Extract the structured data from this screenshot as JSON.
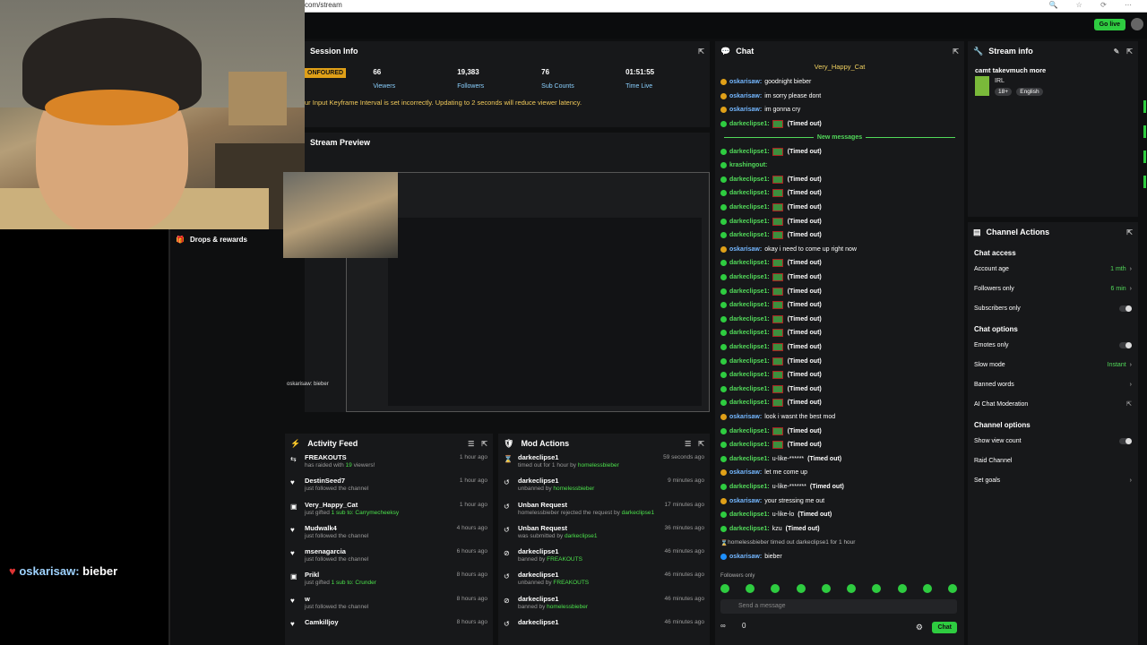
{
  "browser": {
    "url": "com/stream"
  },
  "topbar": {
    "go_live": "Go live"
  },
  "overlay": {
    "chat_user": "oskarisaw:",
    "chat_text": "bieber",
    "small_overlay": "oskarisaw: bieber"
  },
  "drops": {
    "title": "Drops & rewards"
  },
  "session": {
    "title": "Session Info",
    "badge": "ONFOURED",
    "stats": [
      {
        "value": "66",
        "label": "Viewers"
      },
      {
        "value": "19,383",
        "label": "Followers"
      },
      {
        "value": "76",
        "label": "Sub Counts"
      },
      {
        "value": "01:51:55",
        "label": "Time Live"
      }
    ],
    "warning": "ur Input Keyframe Interval is set incorrectly. Updating to 2 seconds will reduce viewer latency."
  },
  "preview": {
    "title": "Stream Preview"
  },
  "activity": {
    "title": "Activity Feed",
    "items": [
      {
        "icon": "raid-icon",
        "name": "FREAKOUTS",
        "sub_pre": "has raided with ",
        "sub_hl": "19",
        "sub_post": " viewers!",
        "time": "1 hour ago"
      },
      {
        "icon": "heart-icon",
        "name": "DestinSeed7",
        "sub_pre": "just followed the channel",
        "sub_hl": "",
        "sub_post": "",
        "time": "1 hour ago"
      },
      {
        "icon": "gift-icon",
        "name": "Very_Happy_Cat",
        "sub_pre": "just gifted ",
        "sub_hl": "1 sub to: Carrymecheeksy",
        "sub_post": "",
        "time": "1 hour ago"
      },
      {
        "icon": "heart-icon",
        "name": "Mudwalk4",
        "sub_pre": "just followed the channel",
        "sub_hl": "",
        "sub_post": "",
        "time": "4 hours ago"
      },
      {
        "icon": "heart-icon",
        "name": "msenagarcia",
        "sub_pre": "just followed the channel",
        "sub_hl": "",
        "sub_post": "",
        "time": "6 hours ago"
      },
      {
        "icon": "gift-icon",
        "name": "Prikl",
        "sub_pre": "just gifted ",
        "sub_hl": "1 sub to: Crunder",
        "sub_post": "",
        "time": "8 hours ago"
      },
      {
        "icon": "heart-icon",
        "name": "w",
        "sub_pre": "just followed the channel",
        "sub_hl": "",
        "sub_post": "",
        "time": "8 hours ago"
      },
      {
        "icon": "heart-icon",
        "name": "Camkilljoy",
        "sub_pre": "",
        "sub_hl": "",
        "sub_post": "",
        "time": "8 hours ago"
      }
    ]
  },
  "mod": {
    "title": "Mod Actions",
    "items": [
      {
        "icon": "hourglass-icon",
        "name": "darkeclipse1",
        "sub_pre": "timed out for 1 hour by ",
        "sub_hl": "homelessbieber",
        "time": "59 seconds ago"
      },
      {
        "icon": "undo-icon",
        "name": "darkeclipse1",
        "sub_pre": "unbanned by ",
        "sub_hl": "homelessbieber",
        "time": "9 minutes ago"
      },
      {
        "icon": "undo-icon",
        "name": "Unban Request",
        "sub_pre": "homelessbieber rejected the request by ",
        "sub_hl": "darkeclipse1",
        "time": "17 minutes ago"
      },
      {
        "icon": "undo-icon",
        "name": "Unban Request",
        "sub_pre": "was submitted by ",
        "sub_hl": "darkeclipse1",
        "time": "36 minutes ago"
      },
      {
        "icon": "ban-icon",
        "name": "darkeclipse1",
        "sub_pre": "banned by ",
        "sub_hl": "FREAKOUTS",
        "time": "46 minutes ago"
      },
      {
        "icon": "undo-icon",
        "name": "darkeclipse1",
        "sub_pre": "unbanned by ",
        "sub_hl": "FREAKOUTS",
        "time": "46 minutes ago"
      },
      {
        "icon": "ban-icon",
        "name": "darkeclipse1",
        "sub_pre": "banned by ",
        "sub_hl": "homelessbieber",
        "time": "46 minutes ago"
      },
      {
        "icon": "undo-icon",
        "name": "darkeclipse1",
        "sub_pre": "",
        "sub_hl": "",
        "time": "46 minutes ago"
      }
    ]
  },
  "chat": {
    "title": "Chat",
    "pinned": "Very_Happy_Cat",
    "new_messages": "New messages",
    "timed_out": "(Timed out)",
    "followers_only": "Followers only",
    "placeholder": "Send a message",
    "send": "Chat",
    "foot_left": "∞",
    "foot_count": "0",
    "lines_a": [
      {
        "u": "oskarisaw:",
        "c": "bl",
        "msg": "goodnight bieber",
        "t": false
      },
      {
        "u": "oskarisaw:",
        "c": "bl",
        "msg": "im sorry please dont",
        "t": false
      },
      {
        "u": "oskarisaw:",
        "c": "bl",
        "msg": "im gonna cry",
        "t": false
      },
      {
        "u": "darkeclipse1:",
        "c": "gr",
        "msg": "",
        "t": true
      }
    ],
    "lines_b": [
      {
        "u": "darkeclipse1:",
        "c": "gr",
        "msg": "",
        "t": true
      },
      {
        "u": "krashingout:",
        "c": "gr",
        "msg": "",
        "t": false
      },
      {
        "u": "darkeclipse1:",
        "c": "gr",
        "msg": "",
        "t": true
      },
      {
        "u": "darkeclipse1:",
        "c": "gr",
        "msg": "",
        "t": true
      },
      {
        "u": "darkeclipse1:",
        "c": "gr",
        "msg": "",
        "t": true
      },
      {
        "u": "darkeclipse1:",
        "c": "gr",
        "msg": "",
        "t": true
      },
      {
        "u": "darkeclipse1:",
        "c": "gr",
        "msg": "",
        "t": true
      },
      {
        "u": "oskarisaw:",
        "c": "bl",
        "msg": "okay i need to come up right now",
        "t": false
      },
      {
        "u": "darkeclipse1:",
        "c": "gr",
        "msg": "",
        "t": true
      },
      {
        "u": "darkeclipse1:",
        "c": "gr",
        "msg": "",
        "t": true
      },
      {
        "u": "darkeclipse1:",
        "c": "gr",
        "msg": "",
        "t": true
      },
      {
        "u": "darkeclipse1:",
        "c": "gr",
        "msg": "",
        "t": true
      },
      {
        "u": "darkeclipse1:",
        "c": "gr",
        "msg": "",
        "t": true
      },
      {
        "u": "darkeclipse1:",
        "c": "gr",
        "msg": "",
        "t": true
      },
      {
        "u": "darkeclipse1:",
        "c": "gr",
        "msg": "",
        "t": true
      },
      {
        "u": "darkeclipse1:",
        "c": "gr",
        "msg": "",
        "t": true
      },
      {
        "u": "darkeclipse1:",
        "c": "gr",
        "msg": "",
        "t": true
      },
      {
        "u": "darkeclipse1:",
        "c": "gr",
        "msg": "",
        "t": true
      },
      {
        "u": "darkeclipse1:",
        "c": "gr",
        "msg": "",
        "t": true
      },
      {
        "u": "oskarisaw:",
        "c": "bl",
        "msg": "look i wasnt the best mod",
        "t": false
      },
      {
        "u": "darkeclipse1:",
        "c": "gr",
        "msg": "",
        "t": true
      },
      {
        "u": "darkeclipse1:",
        "c": "gr",
        "msg": "",
        "t": true
      },
      {
        "u": "darkeclipse1:",
        "c": "gr",
        "msg": "u-like-******",
        "t": true
      },
      {
        "u": "oskarisaw:",
        "c": "bl",
        "msg": "let me come up",
        "t": false
      },
      {
        "u": "darkeclipse1:",
        "c": "gr",
        "msg": "u-like-*******",
        "t": true
      },
      {
        "u": "oskarisaw:",
        "c": "bl",
        "msg": "your stressing me out",
        "t": false
      },
      {
        "u": "darkeclipse1:",
        "c": "gr",
        "msg": "u-like-lo",
        "t": true
      },
      {
        "u": "darkeclipse1:",
        "c": "gr",
        "msg": "kzu",
        "t": true
      }
    ],
    "sys_line": "homelessbieber timed out darkeclipse1 for 1 hour",
    "last_user": "oskarisaw:",
    "last_msg": "bieber"
  },
  "streaminfo": {
    "title": "Stream info",
    "stream_title": "camt takevmuch more",
    "category": "IRL",
    "tags": [
      "18+",
      "English"
    ]
  },
  "channel": {
    "title": "Channel Actions",
    "sections": [
      {
        "heading": "Chat access",
        "rows": [
          {
            "label": "Account age",
            "value": "1 mth",
            "kind": "chev"
          },
          {
            "label": "Followers only",
            "value": "6 min",
            "kind": "chev"
          },
          {
            "label": "Subscribers only",
            "value": "",
            "kind": "toggle"
          }
        ]
      },
      {
        "heading": "Chat options",
        "rows": [
          {
            "label": "Emotes only",
            "value": "",
            "kind": "toggle"
          },
          {
            "label": "Slow mode",
            "value": "Instant",
            "kind": "chev"
          },
          {
            "label": "Banned words",
            "value": "",
            "kind": "chev"
          },
          {
            "label": "AI Chat Moderation",
            "value": "",
            "kind": "ext"
          }
        ]
      },
      {
        "heading": "Channel options",
        "rows": [
          {
            "label": "Show view count",
            "value": "",
            "kind": "toggle"
          },
          {
            "label": "Raid Channel",
            "value": "",
            "kind": "none"
          },
          {
            "label": "Set goals",
            "value": "",
            "kind": "chev"
          }
        ]
      }
    ]
  },
  "colors": {
    "accent": "#2ecc40",
    "bg": "#0e0f10",
    "panel": "#17181a"
  }
}
